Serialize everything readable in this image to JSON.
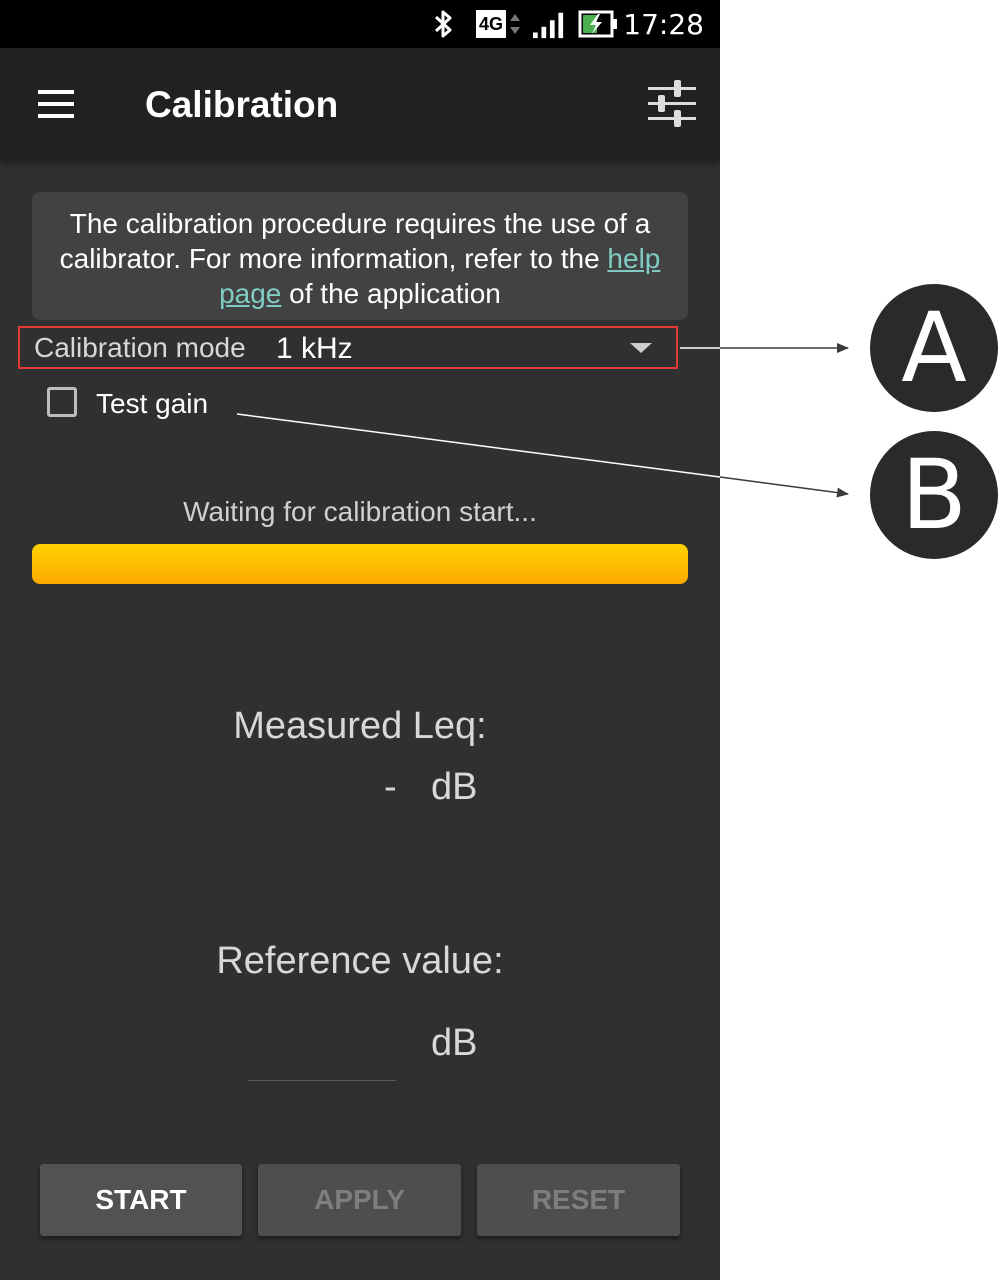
{
  "status_bar": {
    "time": "17:28",
    "network_label": "4G",
    "icons": [
      "bluetooth-icon",
      "network-4g-icon",
      "signal-icon",
      "battery-charging-icon"
    ]
  },
  "app_bar": {
    "title": "Calibration",
    "menu_icon": "hamburger-menu-icon",
    "action_icon": "tune-sliders-icon"
  },
  "info_box": {
    "text_before_link": "The calibration procedure requires the use of a calibrator. For more information, refer to the ",
    "link_text": "help page",
    "text_after_link": " of the application"
  },
  "calibration_mode": {
    "label": "Calibration mode",
    "selected": "1 kHz",
    "highlight_color": "#e53935"
  },
  "test_gain": {
    "label": "Test gain",
    "checked": false
  },
  "status": {
    "text": "Waiting for calibration start...",
    "progress_color": "#ffc107"
  },
  "measured": {
    "label": "Measured Leq:",
    "value": "-",
    "unit": "dB"
  },
  "reference": {
    "label": "Reference value:",
    "value": "",
    "unit": "dB"
  },
  "buttons": {
    "start": "START",
    "apply": "APPLY",
    "reset": "RESET"
  },
  "callouts": {
    "a": "A",
    "b": "B"
  }
}
